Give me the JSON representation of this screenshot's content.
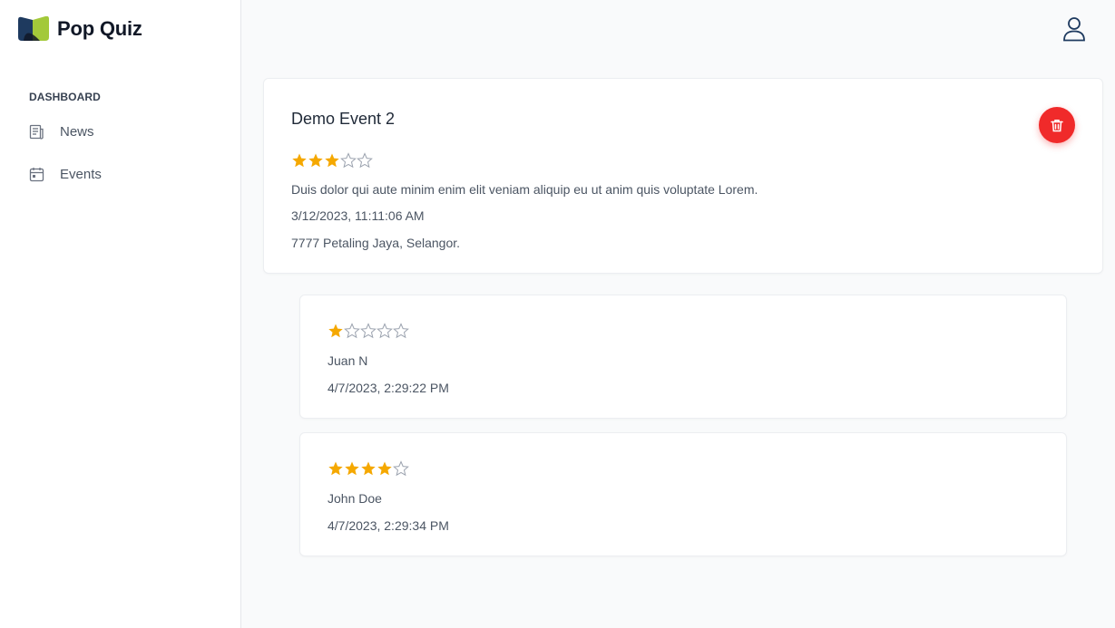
{
  "app": {
    "name": "Pop Quiz",
    "brand_colors": {
      "navy": "#1e3a5f",
      "green": "#a3c93a"
    }
  },
  "sidebar": {
    "section_label": "DASHBOARD",
    "items": [
      {
        "label": "News",
        "icon": "newspaper-icon"
      },
      {
        "label": "Events",
        "icon": "calendar-icon"
      }
    ]
  },
  "header": {
    "user_icon": "user-icon"
  },
  "event": {
    "title": "Demo Event 2",
    "rating": 3,
    "rating_max": 5,
    "description": "Duis dolor qui aute minim enim elit veniam aliquip eu ut anim quis voluptate Lorem.",
    "date": "3/12/2023, 11:11:06 AM",
    "location": "7777 Petaling Jaya, Selangor.",
    "delete_icon": "trash-icon",
    "delete_color": "#f02a2a"
  },
  "reviews": [
    {
      "rating": 1,
      "rating_max": 5,
      "name": "Juan N",
      "time": "4/7/2023, 2:29:22 PM"
    },
    {
      "rating": 4,
      "rating_max": 5,
      "name": "John Doe",
      "time": "4/7/2023, 2:29:34 PM"
    }
  ],
  "colors": {
    "star_filled": "#f5a800",
    "star_empty": "#9ca3af"
  }
}
